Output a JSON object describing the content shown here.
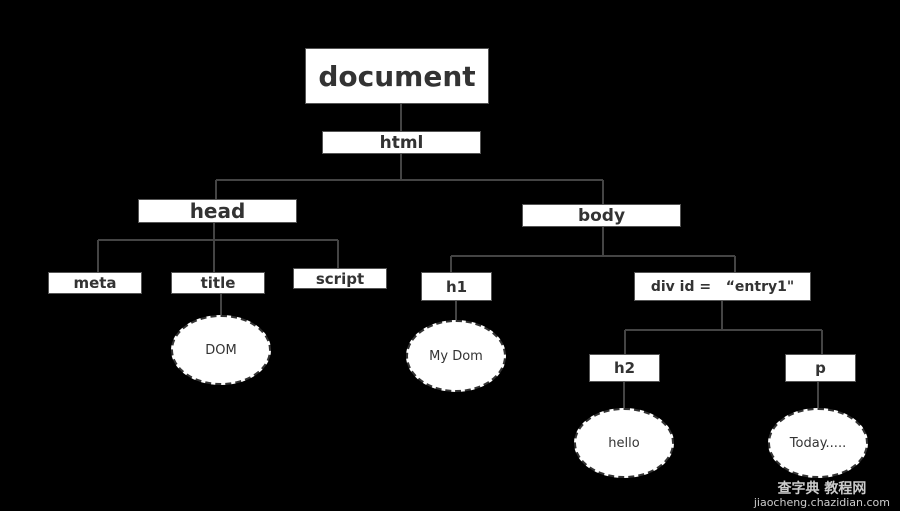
{
  "nodes": {
    "document": "document",
    "html": "html",
    "head": "head",
    "body": "body",
    "meta": "meta",
    "title": "title",
    "script": "script",
    "h1": "h1",
    "div": "div id =   “entry1\"",
    "h2": "h2",
    "p": "p"
  },
  "text_nodes": {
    "dom": "DOM",
    "my_dom": "My Dom",
    "hello": "hello",
    "today": "Today....."
  },
  "watermark": {
    "line1": "查字典 教程网",
    "line2": "jiaocheng.chazidian.com"
  },
  "colors": {
    "background": "#000000",
    "box": "#ffffff",
    "line": "#444444",
    "text": "#333333"
  }
}
